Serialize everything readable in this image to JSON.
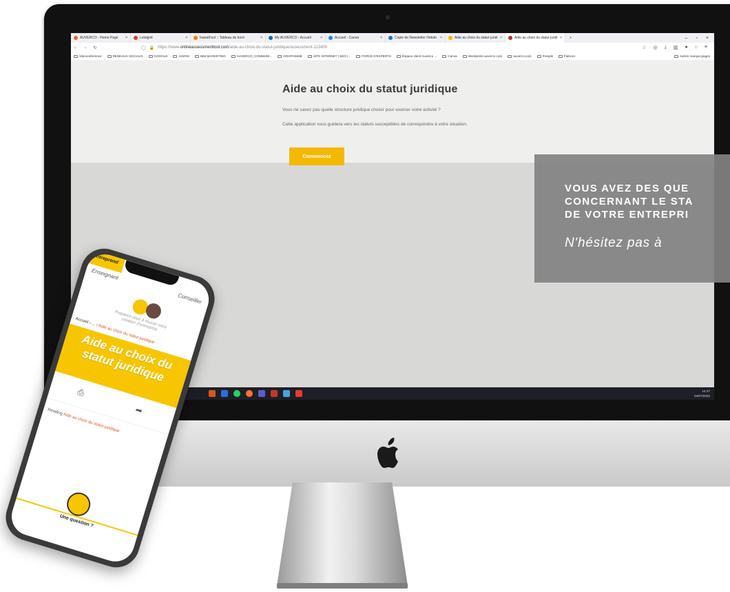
{
  "browser": {
    "tabs": [
      {
        "label": "AUVERCO - Home Page",
        "color": "#e86a2c"
      },
      {
        "label": "Letsignit",
        "color": "#e53935"
      },
      {
        "label": "IsanetFact :: Tableau de bord",
        "color": "#f57c00"
      },
      {
        "label": "My AUVERCO - Accueil",
        "color": "#1565c0"
      },
      {
        "label": "Accueil - Canva",
        "color": "#1e88e5"
      },
      {
        "label": "Copie de Newsletter Hebdo",
        "color": "#1976d2"
      },
      {
        "label": "Aide au choix du statut juridi",
        "color": "#f5b800"
      },
      {
        "label": "Aide au choix du statut juridi",
        "color": "#c62828"
      }
    ],
    "url_prefix": "https://www.",
    "url_domain": "onlineassessmenttool.com",
    "url_path": "/aide-au-choix-du-statut-juridique/assessment-113400",
    "bookmarks": [
      "Visioconference",
      "RESEAUX SOCIAUX",
      "GOOGLE",
      "AGIRIS",
      "BIM MARKETING",
      "AUVERCO_COMMUNI...",
      "GRAPHISME",
      "SITE INTERNET | SEO |...",
      "FORCE D'EXPERTS",
      "Espace client Auverco ...",
      "Canva",
      "Wordpress auverco.com",
      "auverco.com",
      "Freepik",
      "Flaticon"
    ],
    "other_bookmarks": "Autres marque-pages"
  },
  "page": {
    "title": "Aide au choix du statut juridique",
    "paragraph1": "Vous ne savez pas quelle structure juridique choisir pour exercer votre activité ?",
    "paragraph2": "Cette application vous guidera vers les statuts susceptibles de correspondre à votre situation.",
    "start_button": "Commencez",
    "accent_color": "#f5b800"
  },
  "taskbar": {
    "time": "14:27",
    "date": "04/07/2022"
  },
  "promo": {
    "line1": "VOUS AVEZ DES QUE",
    "line2": "CONCERNANT LE STA",
    "line3": "DE VOTRE ENTREPRI",
    "subtitle": "N'hésitez pas à"
  },
  "phone": {
    "tab_yellow": "Entreprend",
    "tab_left": "Enseignant",
    "tab_right": "Conseiller",
    "tagline": "Préparez-vous à réussir votre création d'entreprise",
    "breadcrumb_home": "Accueil",
    "breadcrumb_sep": "› ... ›",
    "breadcrumb_current": "Aide au choix du statut juridique",
    "hero_title": "Aide au choix du statut juridique",
    "reading_prefix": "Reading",
    "reading_title": "Aide au choix du statut juridique",
    "question": "Une question ?"
  }
}
